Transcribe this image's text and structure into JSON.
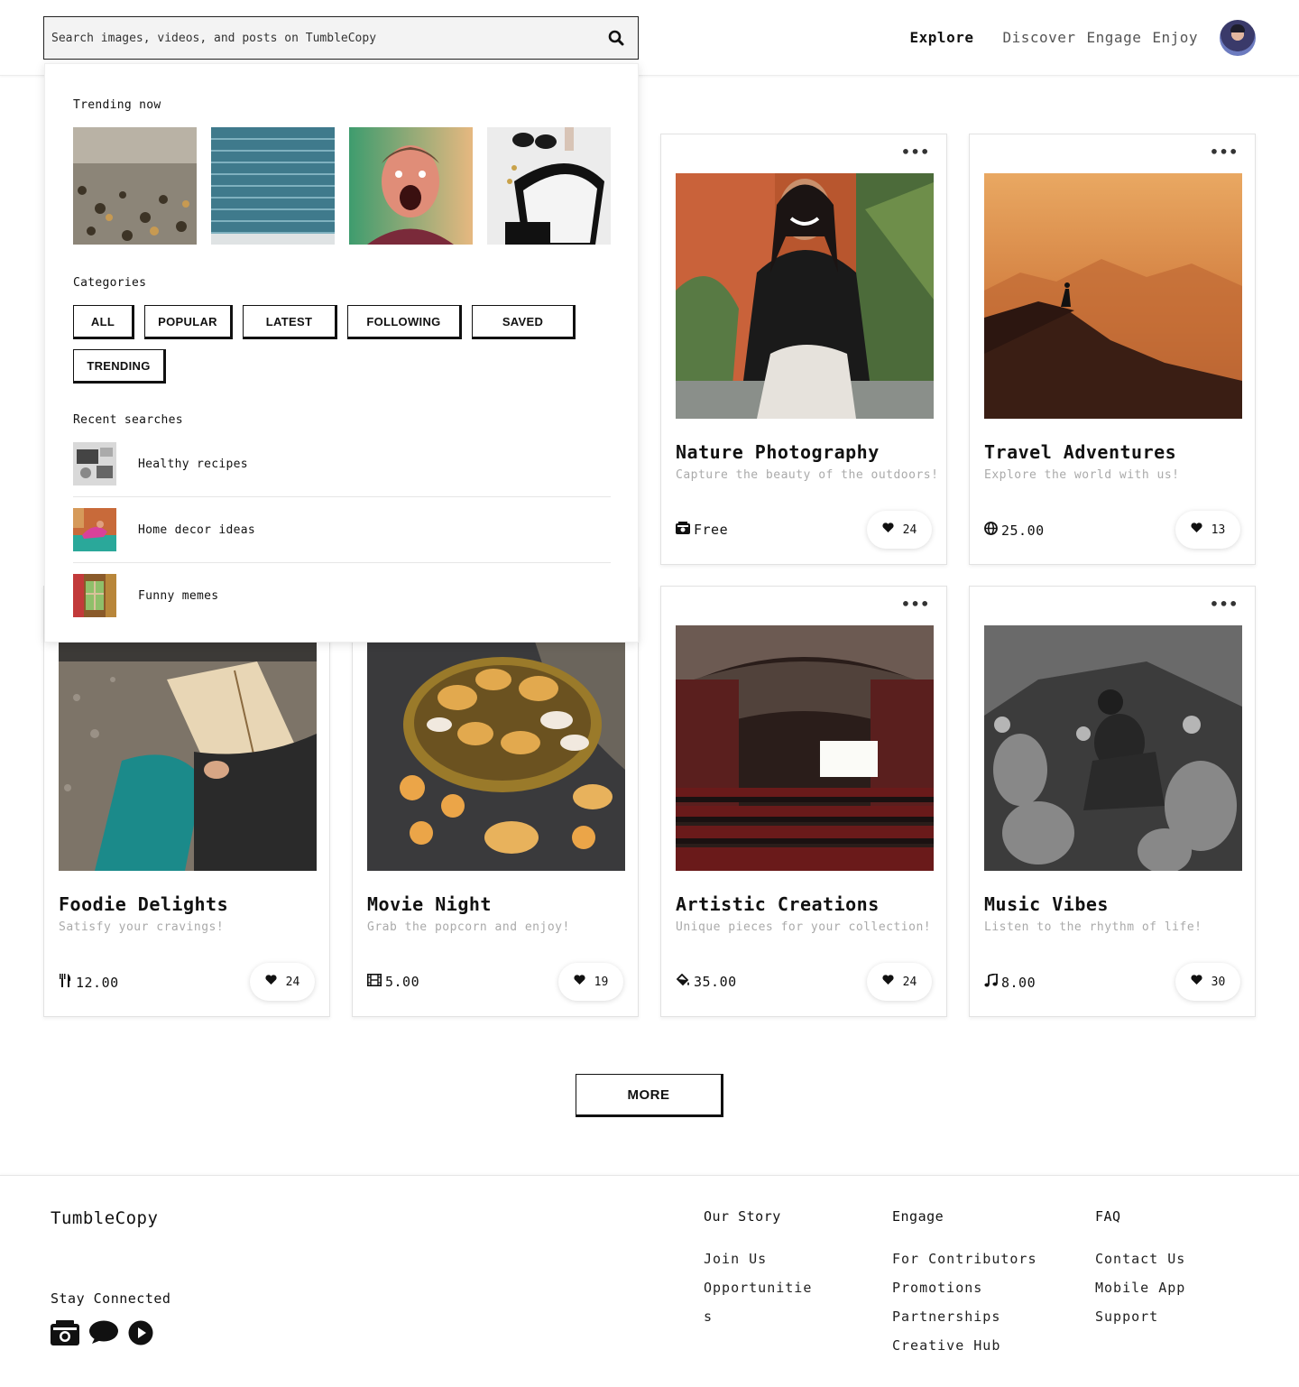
{
  "header": {
    "search_placeholder": "Search images, videos, and posts on TumbleCopy",
    "nav": [
      "Explore",
      "Discover",
      "Engage",
      "Enjoy"
    ]
  },
  "dropdown": {
    "trending_heading": "Trending now",
    "trending_images": [
      "pebble-beach-image",
      "blue-brick-wall-image",
      "surprised-man-image",
      "flat-lay-accessories-image"
    ],
    "categories_heading": "Categories",
    "categories": [
      "ALL",
      "POPULAR",
      "LATEST",
      "FOLLOWING",
      "SAVED",
      "TRENDING"
    ],
    "recent_heading": "Recent searches",
    "recent": [
      {
        "label": "Healthy recipes",
        "thumb": "desk-gadgets-image"
      },
      {
        "label": "Home decor ideas",
        "thumb": "yoga-room-image"
      },
      {
        "label": "Funny memes",
        "thumb": "window-room-image"
      }
    ]
  },
  "cards": [
    {
      "title": "Nature Photography",
      "subtitle": "Capture the beauty of the outdoors!",
      "price": "Free",
      "price_icon": "camera-icon",
      "likes": "24",
      "image": "smiling-woman-leather-jacket-image"
    },
    {
      "title": "Travel Adventures",
      "subtitle": "Explore the world with us!",
      "price": "25.00",
      "price_icon": "globe-icon",
      "likes": "13",
      "image": "hiker-mountain-sunset-image"
    },
    {
      "title": "Foodie Delights",
      "subtitle": "Satisfy your cravings!",
      "price": "12.00",
      "price_icon": "utensils-icon",
      "likes": "24",
      "image": "person-reading-book-image"
    },
    {
      "title": "Movie Night",
      "subtitle": "Grab the popcorn and enjoy!",
      "price": "5.00",
      "price_icon": "film-icon",
      "likes": "19",
      "image": "pastries-tray-image"
    },
    {
      "title": "Artistic Creations",
      "subtitle": "Unique pieces for your collection!",
      "price": "35.00",
      "price_icon": "paint-bucket-icon",
      "likes": "24",
      "image": "cinema-hall-image"
    },
    {
      "title": "Music Vibes",
      "subtitle": "Listen to the rhythm of life!",
      "price": "8.00",
      "price_icon": "music-note-icon",
      "likes": "30",
      "image": "sculptor-workshop-image"
    }
  ],
  "more_label": "MORE",
  "footer": {
    "brand": "TumbleCopy",
    "stay_connected": "Stay Connected",
    "social_icons": [
      "camera-icon",
      "chat-bubble-icon",
      "play-icon"
    ],
    "columns": [
      {
        "heading": "Our Story",
        "links": [
          "Join Us",
          "Opportunitie",
          "s"
        ]
      },
      {
        "heading": "Engage",
        "links": [
          "For Contributors",
          "Promotions",
          "Partnerships",
          "Creative Hub"
        ]
      },
      {
        "heading": "FAQ",
        "links": [
          "Contact Us",
          "Mobile App",
          "Support"
        ]
      }
    ]
  },
  "colors": {
    "accent": "#111111",
    "muted_text": "#aaaaaa",
    "search_bg": "#f3f3f3"
  }
}
